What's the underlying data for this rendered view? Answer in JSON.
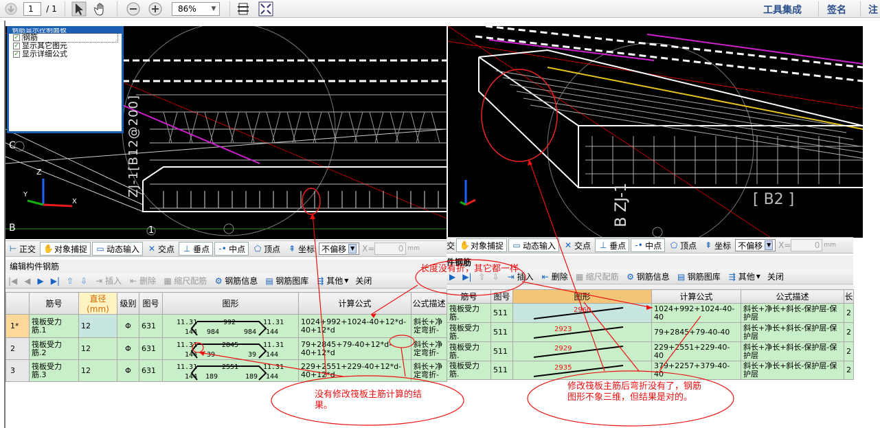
{
  "toolbar": {
    "page_current": "1",
    "page_total": "/ 1",
    "zoom": "86%",
    "tools_label": "工具集成",
    "sign_label": "签名",
    "note_label": "注"
  },
  "left_viewport": {
    "control_panel": {
      "title": "钢筋显示控制面板",
      "items": [
        "钢筋",
        "显示其它图元",
        "显示详细公式"
      ]
    },
    "axis_labels": [
      "C",
      "B",
      "1"
    ],
    "axis_names": [
      "Z",
      "Y",
      "X"
    ],
    "vertical_text": "ZJ-1[B12@200]"
  },
  "right_viewport": {
    "vertical_text": "B ZJ-1",
    "label": "[ B2 ]"
  },
  "snap_bar_left": {
    "items": [
      "正交",
      "对象捕捉",
      "动态输入",
      "交点",
      "垂点",
      "中点",
      "顶点",
      "坐标"
    ],
    "offset_option": "不偏移",
    "x_label": "X=",
    "x_value": "0",
    "unit": "mm"
  },
  "snap_bar_right": {
    "items": [
      "交",
      "对象捕捉",
      "动态输入",
      "交点",
      "垂点",
      "中点",
      "顶点",
      "坐标"
    ],
    "offset_option": "不偏移",
    "x_label": "X=",
    "x_value": "0",
    "unit": "mm"
  },
  "left_panel": {
    "caption": "编辑构件钢筋",
    "actions": [
      "插入",
      "删除",
      "缩尺配筋",
      "钢筋信息",
      "钢筋图库",
      "其他",
      "关闭"
    ],
    "columns": [
      "筋号",
      "直径(mm)",
      "级别",
      "图号",
      "图形",
      "计算公式",
      "公式描述"
    ],
    "rows": [
      {
        "idx": "1*",
        "name": "筏板受力筋.1",
        "dia": "12",
        "grade": "Φ",
        "fig": "631",
        "shape": {
          "tl": "11.31",
          "mid": "992",
          "tr": "11.31",
          "bl": "144",
          "b1": "984",
          "b2": "984",
          "br": "144"
        },
        "formula": "1024+992+1024-40+12*d-40+12*d",
        "desc": "斜长+净定弯折-"
      },
      {
        "idx": "2",
        "name": "筏板受力筋.2",
        "dia": "12",
        "grade": "Φ",
        "fig": "631",
        "shape": {
          "tl": "11.31",
          "mid": "2845",
          "tr": "11.31",
          "bl": "144",
          "b1": "39",
          "b2": "39",
          "br": "144"
        },
        "formula": "79+2845+79-40+12*d-40+12*d",
        "desc": "斜长+净定弯折-"
      },
      {
        "idx": "3",
        "name": "筏板受力筋.3",
        "dia": "12",
        "grade": "Φ",
        "fig": "631",
        "shape": {
          "tl": "11.31",
          "mid": "2551",
          "tr": "11.31",
          "bl": "144",
          "b1": "189",
          "b2": "189",
          "br": "144"
        },
        "formula": "229+2551+229-40+12*d-40+12*d",
        "desc": "斜长+净定弯折-"
      }
    ]
  },
  "right_panel": {
    "caption": "件钢筋",
    "actions": [
      "插入",
      "删除",
      "缩尺配筋",
      "钢筋信息",
      "钢筋图库",
      "其他",
      "关闭"
    ],
    "columns": [
      "筋号",
      "图号",
      "图形",
      "计算公式",
      "公式描述",
      "长"
    ],
    "rows": [
      {
        "name": "筏板受力筋.",
        "fig": "511",
        "len": "2960",
        "formula": "1024+992+1024-40-40",
        "desc": "斜长+净长+斜长-保护层-保护层",
        "extra": "2"
      },
      {
        "name": "筏板受力筋.",
        "fig": "511",
        "len": "2923",
        "formula": "79+2845+79-40-40",
        "desc": "斜长+净长+斜长-保护层-保护层",
        "extra": "2"
      },
      {
        "name": "筏板受力筋.",
        "fig": "511",
        "len": "2929",
        "formula": "229+2551+229-40-40",
        "desc": "斜长+净长+斜长-保护层-保护层",
        "extra": "2"
      },
      {
        "name": "筏板受力筋.",
        "fig": "511",
        "len": "2935",
        "formula": "379+2257+379-40-40",
        "desc": "斜长+净长+斜长-保护层-保护层",
        "extra": "2"
      }
    ]
  },
  "annotations": {
    "top_note": "长度没有折，其它都一样",
    "left_note": "没有修改筏板主筋计算的结果。",
    "right_note": "修改筏板主筋后弯折没有了，钢筋图形不象三维，但结果是对的。"
  },
  "colors": {
    "grid_green": "#c9efc9",
    "annotation_red": "#e11111",
    "header_blue": "#1a5fb4"
  }
}
